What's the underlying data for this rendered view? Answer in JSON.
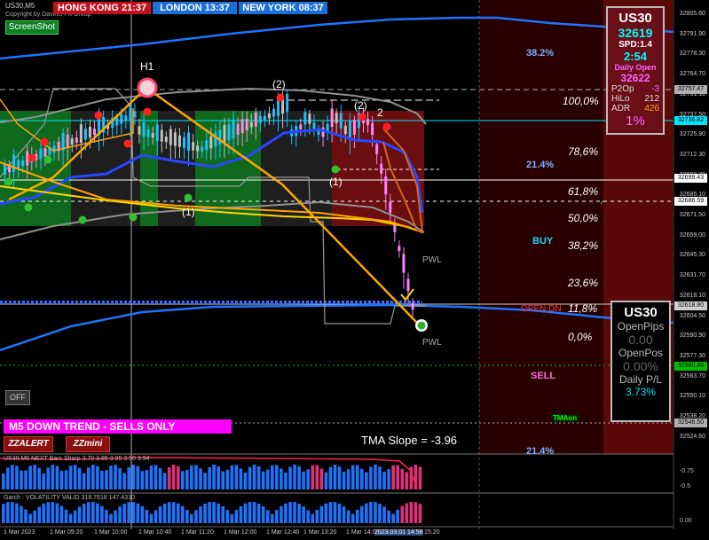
{
  "window": {
    "symbol_title": "US30,M5",
    "copyright": "Copyright by Davinci FX Group"
  },
  "clocks": {
    "hong_kong": "HONG KONG 21:37",
    "london": "LONDON   13:37",
    "new_york": "NEW YORK 08:37"
  },
  "buttons": {
    "screenshot": "ScreenShot",
    "off": "OFF",
    "zzalert": "ZZALERT",
    "zzmini": "ZZmini"
  },
  "trend_banner": "M5  DOWN TREND - SELLS ONLY",
  "tma_slope": "TMA Slope = -3.96",
  "chart_labels": {
    "h1": "H1",
    "two_a": "(2)",
    "two_b": "(2)",
    "two_c": "2",
    "one_a": "(1)",
    "one_b": "(1)",
    "pwl_a": "PWL",
    "pwl_b": "PWL"
  },
  "fib_levels": [
    "100,0%",
    "78,6%",
    "61,8%",
    "50,0%",
    "38,2%",
    "23,6%",
    "11,8%",
    "0,0%"
  ],
  "fib_cyan": [
    "38.2%",
    "21.4%",
    "21.4%"
  ],
  "signals": {
    "buy": "BUY",
    "sell": "SELL",
    "open_dn": "OPEN  DN",
    "tma_on": "TMAon"
  },
  "info_panel": {
    "symbol": "US30",
    "price": "32619",
    "spread": "SPD:1.4",
    "countdown": "2:54",
    "daily_open_label": "Daily Open",
    "daily_open": "32622",
    "rows": [
      {
        "label": "P2Op",
        "value": "-3"
      },
      {
        "label": "HiLo",
        "value": "212"
      },
      {
        "label": "ADR",
        "value": "426"
      }
    ],
    "adr_pct": "1%"
  },
  "position_panel": {
    "symbol": "US30",
    "open_pips_label": "OpenPips",
    "open_pips": "0.00",
    "open_pos_label": "OpenPos",
    "open_pos": "0.00%",
    "daily_pl_label": "Daily P/L",
    "daily_pl": "3.73%"
  },
  "price_axis": [
    "32805.60",
    "32791.90",
    "32778.30",
    "32764.70",
    "32751.10",
    "32737.50",
    "32725.90",
    "32712.30",
    "32698.70",
    "32685.10",
    "32671.50",
    "32659.00",
    "32645.30",
    "32631.70",
    "32618.10",
    "32604.50",
    "32590.90",
    "32577.30",
    "32563.70",
    "32550.10",
    "32538.20",
    "32524.60"
  ],
  "price_tags": [
    {
      "value": "32757.47",
      "color": "#b0b0b0"
    },
    {
      "value": "32736.82",
      "color": "#00e5ff"
    },
    {
      "value": "32699.43",
      "color": "#ffffff"
    },
    {
      "value": "32686.59",
      "color": "#ffffff"
    },
    {
      "value": "32618.80",
      "color": "#cfcfcf"
    },
    {
      "value": "32580.46",
      "color": "#00c000"
    },
    {
      "value": "32546.50",
      "color": "#b0b0b0"
    }
  ],
  "time_axis": [
    "1 Mar 2023",
    "1 Mar 09:20",
    "1 Mar 10:00",
    "1 Mar 10:40",
    "1 Mar 11:20",
    "1 Mar 12:00",
    "1 Mar 12:40",
    "1 Mar 13:20",
    "1 Mar 14:00",
    "2023.03.01 14:58",
    "15:20"
  ],
  "indicators": {
    "sub1": "US30,M5 NEXT Bars Sharp 3.70 3.85 3.95 3.90 3.94",
    "sub2": "Garch : VOLATILITY VALID 318.7618 147.4310",
    "sub1_axis": [
      "-0.75",
      "-0.5"
    ],
    "sub2_axis": [
      "0.00"
    ]
  },
  "colors": {
    "bull_zone": "#0f6a1e",
    "neutral_zone": "#1e1e1e",
    "bear_zone": "#6a0e10",
    "accent_orange": "#ffa500",
    "band_gray": "#909090",
    "tma_blue": "#1e73ff",
    "candle_up": "#1fbfff",
    "candle_dn": "#ff80ff"
  }
}
